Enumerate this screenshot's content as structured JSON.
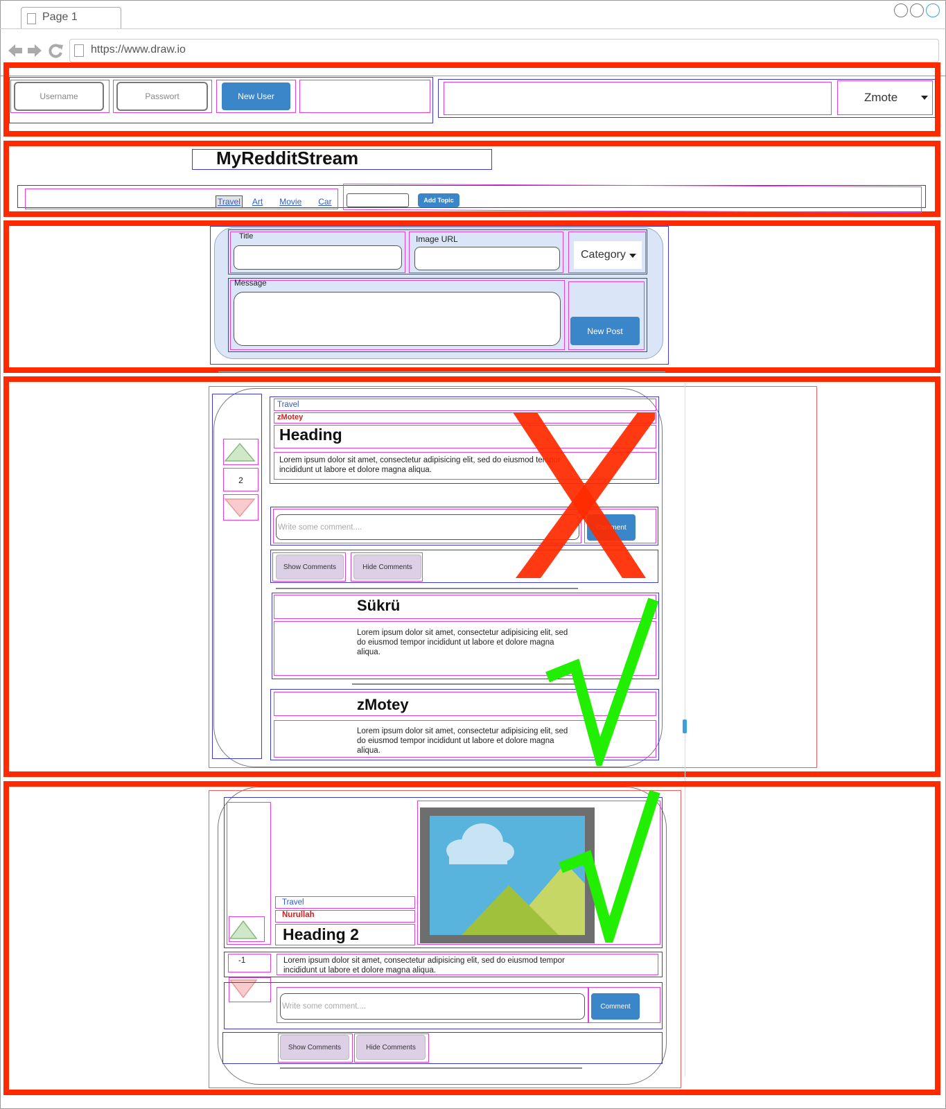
{
  "browser": {
    "tab_title": "Page 1",
    "url": "https://www.draw.io"
  },
  "header": {
    "username_label": "Username",
    "password_label": "Passwort",
    "new_user_label": "New User",
    "user_dropdown_value": "Zmote"
  },
  "title_bar": {
    "site_title": "MyRedditStream",
    "topics": [
      "Travel",
      "Art",
      "Movie",
      "Car"
    ],
    "add_topic_label": "Add Topic"
  },
  "new_post_form": {
    "title_label": "Title",
    "image_url_label": "Image URL",
    "category_label": "Category",
    "message_label": "Message",
    "submit_label": "New Post"
  },
  "post1": {
    "category": "Travel",
    "author": "zMotey",
    "heading": "Heading",
    "body": "Lorem ipsum dolor sit amet, consectetur adipisicing elit, sed do eiusmod tempor incididunt ut labore et dolore magna aliqua.",
    "votes": "2",
    "comment_placeholder": "Write some comment....",
    "comment_button": "Comment",
    "show_comments": "Show Comments",
    "hide_comments": "Hide Comments",
    "comments": [
      {
        "author": "Sükrü",
        "text": "Lorem ipsum dolor sit amet, consectetur adipisicing elit, sed do eiusmod tempor incididunt ut labore et dolore magna aliqua."
      },
      {
        "author": "zMotey",
        "text": "Lorem ipsum dolor sit amet, consectetur adipisicing elit, sed do eiusmod tempor incididunt ut labore et dolore magna aliqua."
      }
    ]
  },
  "post2": {
    "category": "Travel",
    "author": "Nurullah",
    "heading": "Heading 2",
    "body": "Lorem ipsum dolor sit amet, consectetur adipisicing elit, sed do eiusmod tempor incididunt ut labore et dolore magna aliqua.",
    "votes": "-1",
    "comment_placeholder": "Write some comment....",
    "comment_button": "Comment",
    "show_comments": "Show Comments",
    "hide_comments": "Hide Comments"
  },
  "colors": {
    "annotation_red": "#ff2a00",
    "check_green": "#22ee00",
    "primary_button": "#3a86c8",
    "form_background": "#dae6f7",
    "author_red": "#d42020",
    "category_blue": "#2a5bd7"
  }
}
